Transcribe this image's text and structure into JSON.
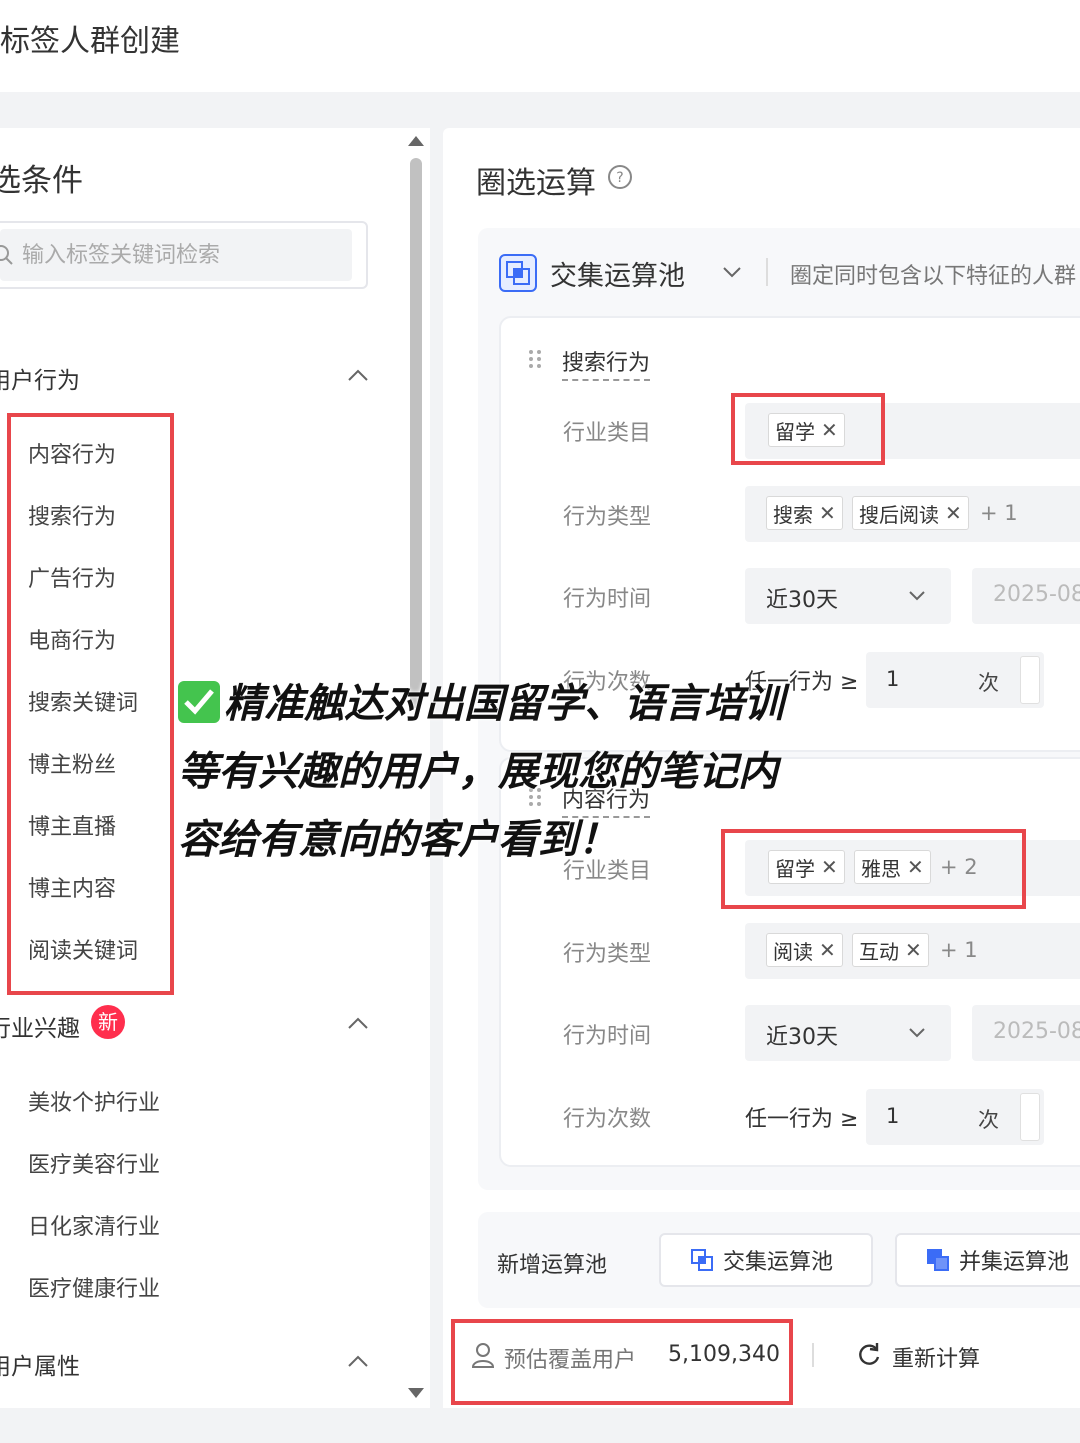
{
  "page": {
    "title": "标签人群创建"
  },
  "left": {
    "title": "选条件",
    "search_placeholder": "输入标签关键词检索",
    "groups": [
      {
        "label": "用户行为",
        "items": [
          "内容行为",
          "搜索行为",
          "广告行为",
          "电商行为",
          "搜索关键词",
          "博主粉丝",
          "博主直播",
          "博主内容",
          "阅读关键词"
        ]
      },
      {
        "label": "行业兴趣",
        "badge": "新",
        "items": [
          "美妆个护行业",
          "医疗美容行业",
          "日化家清行业",
          "医疗健康行业"
        ]
      },
      {
        "label": "用户属性",
        "items": []
      }
    ]
  },
  "right": {
    "title": "圈选运算",
    "pool": {
      "name": "交集运算池",
      "description": "圈定同时包含以下特征的人群"
    },
    "cards": [
      {
        "title": "搜索行为",
        "rows": {
          "industry_label": "行业类目",
          "industry_tags": [
            "留学"
          ],
          "type_label": "行为类型",
          "type_tags": [
            "搜索",
            "搜后阅读"
          ],
          "type_more": "+ 1",
          "time_label": "行为时间",
          "time_value": "近30天",
          "date_value": "2025-08",
          "count_label": "行为次数",
          "count_prefix": "任一行为 ≥",
          "count_value": "1",
          "count_unit": "次"
        }
      },
      {
        "title": "内容行为",
        "rows": {
          "industry_label": "行业类目",
          "industry_tags": [
            "留学",
            "雅思"
          ],
          "industry_more": "+ 2",
          "type_label": "行为类型",
          "type_tags": [
            "阅读",
            "互动"
          ],
          "type_more": "+ 1",
          "time_label": "行为时间",
          "time_value": "近30天",
          "date_value": "2025-08",
          "count_label": "行为次数",
          "count_prefix": "任一行为 ≥",
          "count_value": "1",
          "count_unit": "次"
        }
      }
    ],
    "new_pool": {
      "label": "新增运算池",
      "intersect": "交集运算池",
      "union": "并集运算池"
    },
    "estimate": {
      "label": "预估覆盖用户",
      "value": "5,109,340",
      "recalc": "重新计算"
    }
  },
  "overlay": {
    "lines": [
      "精准触达对出国留学、语言培训",
      "等有兴趣的用户，展现您的笔记内",
      "容给有意向的客户看到！"
    ]
  },
  "colors": {
    "highlight": "#e8464b",
    "accent": "#3b6cf6",
    "badge": "#ff2e4d",
    "check": "#44c44e"
  }
}
